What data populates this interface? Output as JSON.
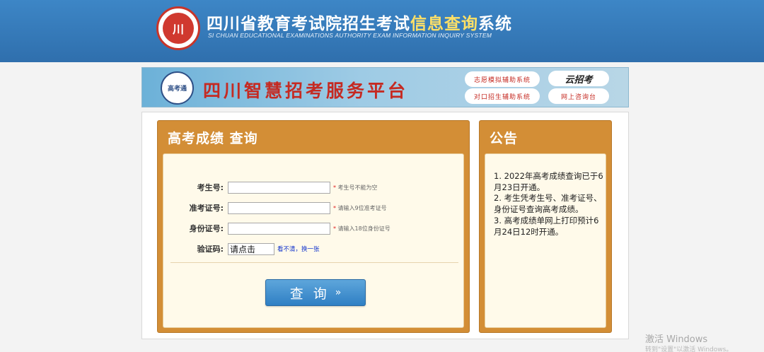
{
  "header": {
    "logo_text": "川",
    "title_part1": "四川省教育考试院招生考试",
    "title_highlight": "信息查询",
    "title_part2": "系统",
    "subtitle": "SI CHUAN EDUCATIONAL EXAMINATIONS AUTHORITY EXAM INFORMATION INQUIRY SYSTEM"
  },
  "banner": {
    "badge_text": "高考通",
    "title": "四川智慧招考服务平台",
    "link_volunteer": "志愿模拟辅助系统",
    "link_counterpart": "对口招生辅助系统",
    "brand": "云招考",
    "link_online": "网上咨询台"
  },
  "query_panel": {
    "title": "高考成绩  查询",
    "fields": [
      {
        "label": "考生号:",
        "value": "",
        "hint": "考生号不能为空"
      },
      {
        "label": "准考证号:",
        "value": "",
        "hint": "请输入9位准考证号"
      },
      {
        "label": "身份证号:",
        "value": "",
        "hint": "请输入18位身份证号"
      }
    ],
    "captcha_label": "验证码:",
    "captcha_text": "请点击",
    "captcha_link": "看不清，换一张",
    "hint_star": "*",
    "submit_label": "查询",
    "submit_arrow": "»"
  },
  "notice_panel": {
    "title": "公告",
    "lines": [
      "1. 2022年高考成绩查询已于6月23日开通。",
      "2. 考生凭考生号、准考证号、身份证号查询高考成绩。",
      "3. 高考成绩单网上打印预计6月24日12时开通。"
    ]
  },
  "watermark": {
    "line1": "激活 Windows",
    "line2": "转到\"设置\"以激活 Windows。"
  },
  "colors": {
    "header_blue": "#3d86c6",
    "panel_orange": "#d38e36",
    "panel_body": "#fffaea",
    "banner_red": "#c52a22",
    "button_blue": "#2f7fc4"
  }
}
